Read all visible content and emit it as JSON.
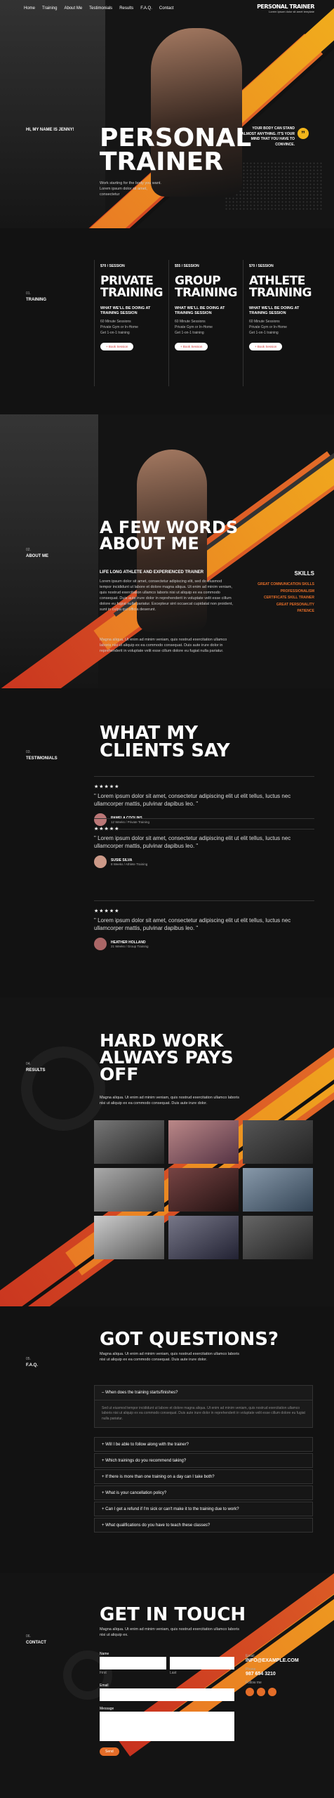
{
  "nav": {
    "links": [
      "Home",
      "Training",
      "About Me",
      "Testimonials",
      "Results",
      "F.A.Q.",
      "Contact"
    ],
    "brand": "PERSONAL TRAINER",
    "brand_sub": "Lorem Ipsum dolor sit amet template"
  },
  "hero": {
    "side_label": "HI, MY NAME IS JENNY!",
    "title_line1": "PERSONAL",
    "title_line2": "TRAINER",
    "tagline": "Work starting for the body you want. Lorem ipsum dolor sit amet, consectetur",
    "right_text": "YOUR BODY CAN STAND ALMOST ANYTHING. IT'S YOUR MIND THAT YOU HAVE TO CONVINCE."
  },
  "training": {
    "num": "01.",
    "label": "TRAINING",
    "cards": [
      {
        "price": "$70 / SESSION",
        "title1": "PRIVATE",
        "title2": "TRAINING",
        "sub": "WHAT WE'LL BE DOING AT TRAINING SESSION",
        "items": [
          "60 Minute Sessions",
          "Private Gym or In-Home",
          "Get 1-on-1 training"
        ],
        "button": "+ Book Session"
      },
      {
        "price": "$55 / SESSION",
        "title1": "GROUP",
        "title2": "TRAINING",
        "sub": "WHAT WE'LL BE DOING AT TRAINING SESSION",
        "items": [
          "60 Minute Sessions",
          "Private Gym or In-Home",
          "Get 1-on-1 training"
        ],
        "button": "+ Book Session"
      },
      {
        "price": "$70 / SESSION",
        "title1": "ATHLETE",
        "title2": "TRAINING",
        "sub": "WHAT WE'LL BE DOING AT TRAINING SESSION",
        "items": [
          "60 Minute Sessions",
          "Private Gym or In-Home",
          "Get 1-on-1 training"
        ],
        "button": "+ Book Session"
      }
    ]
  },
  "about": {
    "num": "02.",
    "label": "ABOUT ME",
    "title1": "A FEW WORDS",
    "title2": "ABOUT ME",
    "sub": "LIFE LONG ATHLETE AND EXPERIENCED TRAINER",
    "p1": "Lorem ipsum dolor sit amet, consectetur adipiscing elit, sed do eiusmod tempor incididunt ut labore et dolore magna aliqua. Ut enim ad minim veniam, quis nostrud exercitation ullamco laboris nisi ut aliquip ex ea commodo consequat. Duis aute irure dolor in reprehenderit in voluptate velit esse cillum dolore eu fugiat nulla pariatur. Excepteur sint occaecat cupidatat non proident, sunt in culpa qui officia deserunt.",
    "p2": "Magna aliqua. Ut enim ad minim veniam, quis nostrud exercitation ullamco laboris nisi ut aliquip ex ea commodo consequat. Duis aute irure dolor in reprehenderit in voluptate velit esse cillum dolore eu fugiat nulla pariatur.",
    "skills_title": "SKILLS",
    "skills": [
      "GREAT COMMUNICATION SKILLS",
      "PROFESSIONALISM",
      "CERTIFICATE SKILL TRAINER",
      "GREAT PERSONALITY",
      "PATIENCE"
    ]
  },
  "testimonials": {
    "num": "03.",
    "label": "TESTIMONIALS",
    "title1": "WHAT MY",
    "title2": "CLIENTS SAY",
    "items": [
      {
        "stars": "★★★★★",
        "quote": "\" Lorem ipsum dolor sit amet, consectetur adipiscing elit ut elit tellus, luctus nec ullamcorper mattis, pulvinar dapibus leo. \"",
        "name": "PAMELA COOLINS",
        "meta": "12 Weeks / Private Training"
      },
      {
        "stars": "★★★★★",
        "quote": "\" Lorem ipsum dolor sit amet, consectetur adipiscing elit ut elit tellus, luctus nec ullamcorper mattis, pulvinar dapibus leo. \"",
        "name": "SUSIE SILVA",
        "meta": "8 Weeks / Athlete Training"
      },
      {
        "stars": "★★★★★",
        "quote": "\" Lorem ipsum dolor sit amet, consectetur adipiscing elit ut elit tellus, luctus nec ullamcorper mattis, pulvinar dapibus leo. \"",
        "name": "HEATHER HOLLAND",
        "meta": "21 Weeks / Group Training"
      }
    ]
  },
  "results": {
    "num": "04.",
    "label": "RESULTS",
    "title1": "HARD WORK",
    "title2": "ALWAYS PAYS",
    "title3": "OFF",
    "text": "Magna aliqua. Ut enim ad minim veniam, quis nostrud exercitation ullamco laboris nisi ut aliquip ex ea commodo consequat. Duis aute irure dolor."
  },
  "faq": {
    "num": "05.",
    "label": "F.A.Q.",
    "title": "GOT QUESTIONS?",
    "text": "Magna aliqua. Ut enim ad minim veniam, quis nostrud exercitation ullamco laboris nisi ut aliquip ex ea commodo consequat. Duis aute irure dolor.",
    "open_q": "When does the training starts/finishes?",
    "open_a": "Sed ut eiusmod tempor incididunt ut labore et dolore magna aliqua. Ut enim ad minim veniam, quis nostrud exercitation ullamco laboris nisi ut aliquip ex ea commodo consequat. Duis aute irure dolor in reprehenderit in voluptate velit esse cillum dolore eu fugiat nulla pariatur.",
    "questions": [
      "Will I be able to follow along with the trainer?",
      "Which trainings do you recommend taking?",
      "If there is more than one training on a day can I take both?",
      "What is your cancellation policy?",
      "Can I get a refund if I'm sick or can't make it to the training due to work?",
      "What qualifications do you have to teach these classes?"
    ]
  },
  "contact": {
    "num": "06.",
    "label": "CONTACT",
    "title": "GET IN TOUCH",
    "text": "Magna aliqua. Ut enim ad minim veniam, quis nostrud exercitation ullamco laboris nisi ut aliquip ex.",
    "name_label": "Name",
    "first": "First",
    "last": "Last",
    "email_label": "Email",
    "message_label": "Message",
    "submit": "Send",
    "email_title": "Email",
    "email": "INFO@EXAMPLE.COM",
    "phone_title": "Phone",
    "phone": "987 654 3210",
    "follow": "Follow me"
  },
  "colors": {
    "accent": "#e46d28",
    "yellow": "#f2b51b",
    "red": "#d9402b",
    "bg": "#121212"
  }
}
